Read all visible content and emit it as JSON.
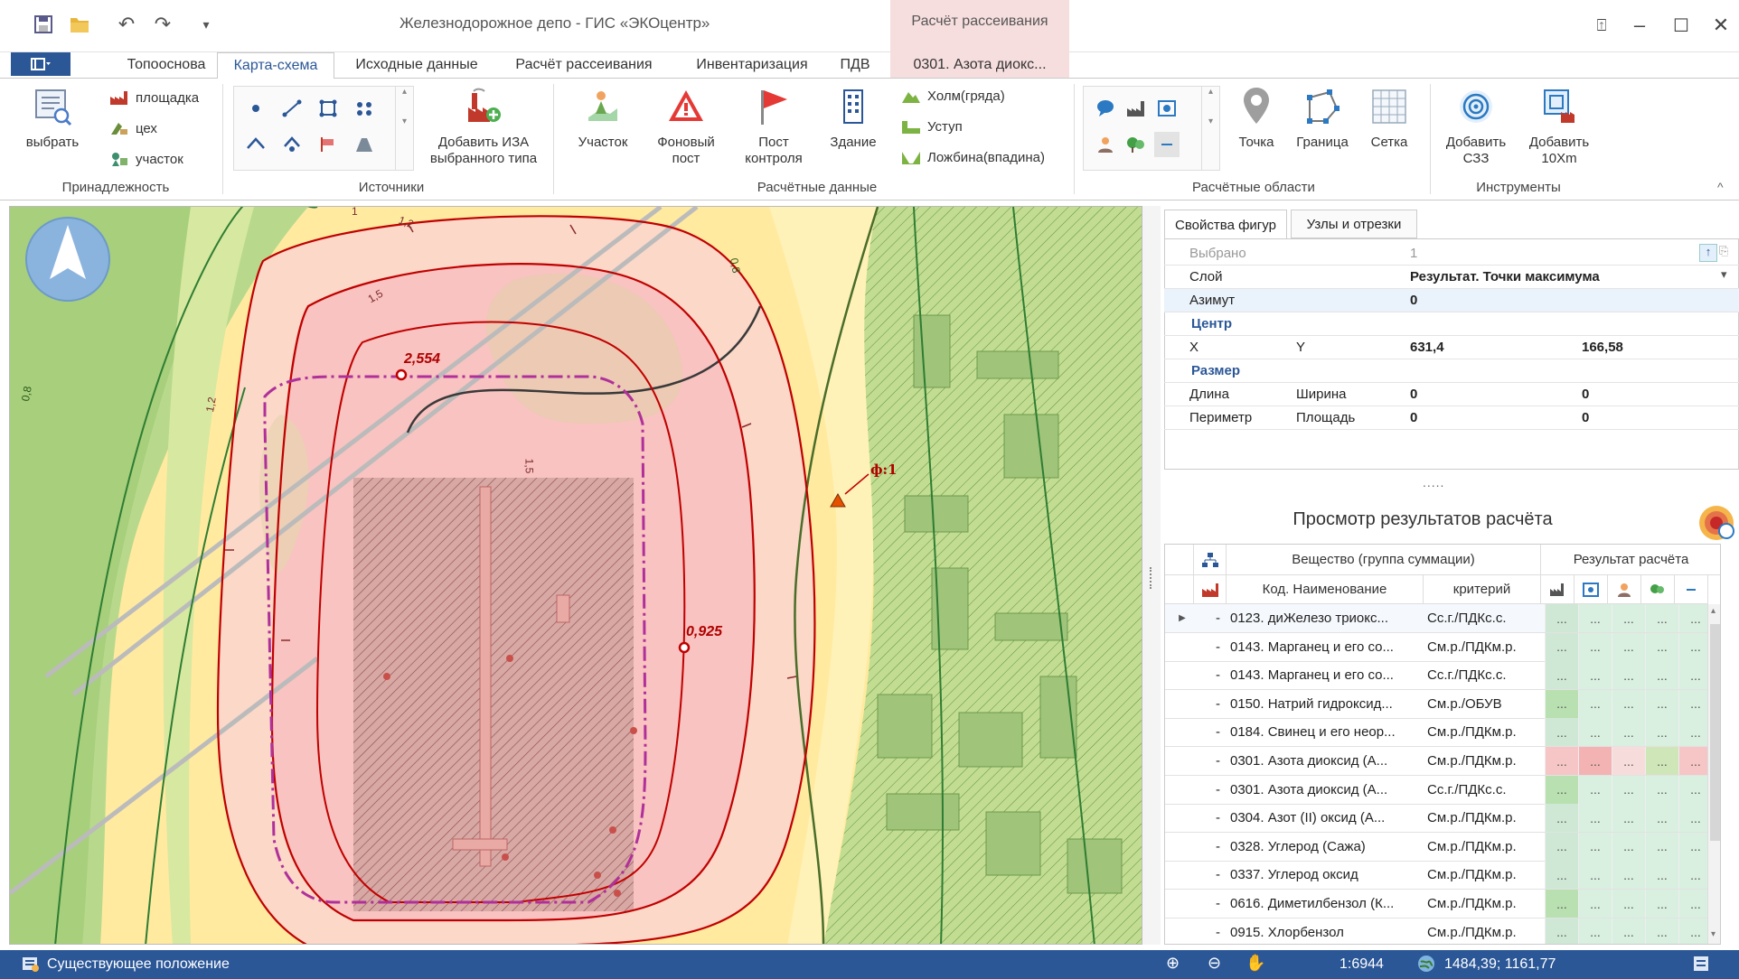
{
  "window": {
    "title": "Железнодорожное депо - ГИС «ЭКОцентр»",
    "context_tab_header": "Расчёт рассеивания"
  },
  "tabs": [
    {
      "label": "Топооснова"
    },
    {
      "label": "Карта-схема"
    },
    {
      "label": "Исходные данные"
    },
    {
      "label": "Расчёт рассеивания"
    },
    {
      "label": "Инвентаризация"
    },
    {
      "label": "ПДВ"
    },
    {
      "label": "0301. Азота диокс..."
    }
  ],
  "ribbon": {
    "select_label": "выбрать",
    "belonging": {
      "items": [
        "площадка",
        "цех",
        "участок"
      ],
      "group_label": "Принадлежность"
    },
    "sources": {
      "add_label": "Добавить ИЗА выбранного типа",
      "group_label": "Источники"
    },
    "calc_data": {
      "buttons": [
        "Участок",
        "Фоновый пост",
        "Пост контроля",
        "Здание"
      ],
      "terrain": [
        "Холм(гряда)",
        "Уступ",
        "Ложбина(впадина)"
      ],
      "group_label": "Расчётные данные"
    },
    "calc_areas": {
      "buttons": [
        "Точка",
        "Граница",
        "Сетка"
      ],
      "group_label": "Расчётные области"
    },
    "tools": {
      "buttons": [
        "Добавить СЗЗ",
        "Добавить 10Xm"
      ],
      "group_label": "Инструменты"
    }
  },
  "map": {
    "max_label_1": "2,554",
    "max_label_2": "0,925",
    "marker_label": "ф:1",
    "iso_labels": [
      "1",
      "1,2",
      "1,5",
      "0,8"
    ]
  },
  "properties": {
    "tabs": [
      "Свойства фигур",
      "Узлы и отрезки"
    ],
    "rows": {
      "selected_label": "Выбрано",
      "selected_value": "1",
      "layer_label": "Слой",
      "layer_value": "Результат. Точки максимума",
      "azimuth_label": "Азимут",
      "azimuth_value": "0",
      "center_label": "Центр",
      "x_label": "X",
      "y_label": "Y",
      "x_value": "631,4",
      "y_value": "166,58",
      "size_label": "Размер",
      "length_label": "Длина",
      "width_label": "Ширина",
      "length_value": "0",
      "width_value": "0",
      "perimeter_label": "Периметр",
      "area_label": "Площадь",
      "perimeter_value": "0",
      "area_value": "0"
    },
    "splitter_dots": "....."
  },
  "results": {
    "title": "Просмотр результатов расчёта",
    "headers": {
      "substance_group": "Вещество (группа суммации)",
      "result": "Результат расчёта",
      "code_name": "Код. Наименование",
      "criterion": "критерий"
    },
    "rows": [
      {
        "name": "0123. диЖелезо триокс...",
        "crit": "Сс.г./ПДКс.с.",
        "colors": [
          "#cfe8d6",
          "#d9efe0",
          "#d9efe0",
          "#d9efe0",
          "#d9efe0"
        ]
      },
      {
        "name": "0143. Марганец и его со...",
        "crit": "См.р./ПДКм.р.",
        "colors": [
          "#cfe8d6",
          "#d9efe0",
          "#d9efe0",
          "#d9efe0",
          "#d9efe0"
        ]
      },
      {
        "name": "0143. Марганец и его со...",
        "crit": "Сс.г./ПДКс.с.",
        "colors": [
          "#cfe8d6",
          "#d9efe0",
          "#d9efe0",
          "#d9efe0",
          "#d9efe0"
        ]
      },
      {
        "name": "0150. Натрий гидроксид...",
        "crit": "См.р./ОБУВ",
        "colors": [
          "#b9e0b0",
          "#d9efe0",
          "#d9efe0",
          "#d9efe0",
          "#d9efe0"
        ]
      },
      {
        "name": "0184. Свинец и его неор...",
        "crit": "См.р./ПДКм.р.",
        "colors": [
          "#cfe8d6",
          "#d9efe0",
          "#d9efe0",
          "#d9efe0",
          "#d9efe0"
        ]
      },
      {
        "name": "0301. Азота диоксид (А...",
        "crit": "См.р./ПДКм.р.",
        "colors": [
          "#f6c6c6",
          "#f3b3b3",
          "#f7dcdc",
          "#cfe6b8",
          "#f6c6c6"
        ]
      },
      {
        "name": "0301. Азота диоксид (А...",
        "crit": "Сс.г./ПДКс.с.",
        "colors": [
          "#b9e0b0",
          "#d9efe0",
          "#d9efe0",
          "#d9efe0",
          "#d9efe0"
        ]
      },
      {
        "name": "0304. Азот (II) оксид (А...",
        "crit": "См.р./ПДКм.р.",
        "colors": [
          "#cfe8d6",
          "#d9efe0",
          "#d9efe0",
          "#d9efe0",
          "#d9efe0"
        ]
      },
      {
        "name": "0328. Углерод (Сажа)",
        "crit": "См.р./ПДКм.р.",
        "colors": [
          "#cfe8d6",
          "#d9efe0",
          "#d9efe0",
          "#d9efe0",
          "#d9efe0"
        ]
      },
      {
        "name": "0337. Углерод оксид",
        "crit": "См.р./ПДКм.р.",
        "colors": [
          "#cfe8d6",
          "#d9efe0",
          "#d9efe0",
          "#d9efe0",
          "#d9efe0"
        ]
      },
      {
        "name": "0616. Диметилбензол (К...",
        "crit": "См.р./ПДКм.р.",
        "colors": [
          "#b9e0b0",
          "#d9efe0",
          "#d9efe0",
          "#d9efe0",
          "#d9efe0"
        ]
      },
      {
        "name": "0915. Хлорбензол",
        "crit": "См.р./ПДКм.р.",
        "colors": [
          "#cfe8d6",
          "#d9efe0",
          "#d9efe0",
          "#d9efe0",
          "#d9efe0"
        ]
      }
    ],
    "row_dash": "-",
    "cell_text": "..."
  },
  "status": {
    "text": "Существующее положение",
    "scale": "1:6944",
    "coords": "1484,39; 1161,77"
  },
  "colors": {
    "accent": "#2b5797",
    "context": "#f7dede",
    "iso_red": "#c00000",
    "iso_purple": "#b0309a"
  }
}
